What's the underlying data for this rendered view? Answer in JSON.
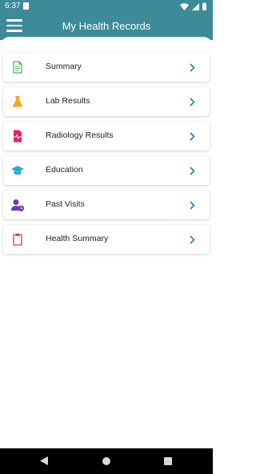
{
  "status_bar": {
    "time": "6:37"
  },
  "app_bar": {
    "title": "My Health Records"
  },
  "records": {
    "items": [
      {
        "label": "Summary",
        "icon": "document-icon",
        "icon_color": "#4caf50"
      },
      {
        "label": "Lab Results",
        "icon": "flask-icon",
        "icon_color": "#f5a623"
      },
      {
        "label": "Radiology Results",
        "icon": "heartbeat-file-icon",
        "icon_color": "#e91e63"
      },
      {
        "label": "Education",
        "icon": "graduation-cap-icon",
        "icon_color": "#29a8e0"
      },
      {
        "label": "Past Visits",
        "icon": "user-clock-icon",
        "icon_color": "#6a3ab2"
      },
      {
        "label": "Health Summary",
        "icon": "clipboard-icon",
        "icon_color": "#e53935"
      }
    ]
  },
  "colors": {
    "accent": "#3d8a99",
    "chevron": "#2c7a95"
  }
}
